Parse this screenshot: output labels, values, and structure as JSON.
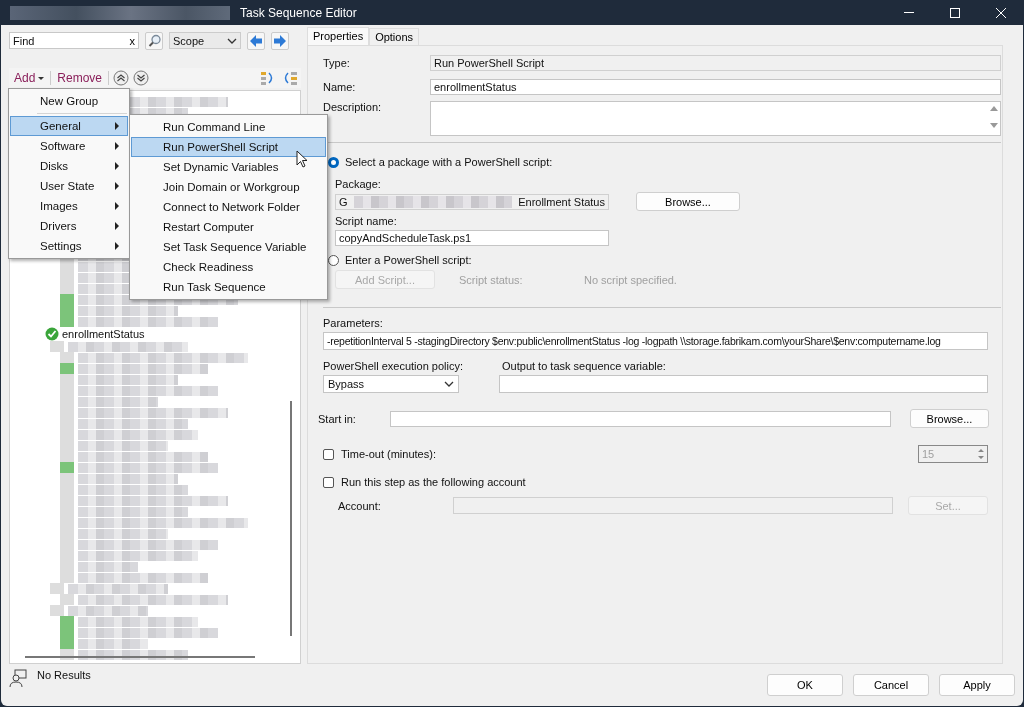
{
  "window": {
    "title": "Task Sequence Editor"
  },
  "search": {
    "value": "Find",
    "clear_label": "x",
    "scope": "Scope"
  },
  "toolbar": {
    "add": "Add",
    "remove": "Remove"
  },
  "add_menu": [
    {
      "label": "New Group",
      "kind": "item",
      "selected": false
    },
    {
      "label": "General",
      "kind": "submenu",
      "selected": true
    },
    {
      "label": "Software",
      "kind": "submenu",
      "selected": false
    },
    {
      "label": "Disks",
      "kind": "submenu",
      "selected": false
    },
    {
      "label": "User State",
      "kind": "submenu",
      "selected": false
    },
    {
      "label": "Images",
      "kind": "submenu",
      "selected": false
    },
    {
      "label": "Drivers",
      "kind": "submenu",
      "selected": false
    },
    {
      "label": "Settings",
      "kind": "submenu",
      "selected": false
    }
  ],
  "general_submenu": [
    {
      "label": "Run Command Line",
      "selected": false
    },
    {
      "label": "Run PowerShell Script",
      "selected": true
    },
    {
      "label": "Set Dynamic Variables",
      "selected": false
    },
    {
      "label": "Join Domain or Workgroup",
      "selected": false
    },
    {
      "label": "Connect to Network Folder",
      "selected": false
    },
    {
      "label": "Restart Computer",
      "selected": false
    },
    {
      "label": "Set Task Sequence Variable",
      "selected": false
    },
    {
      "label": "Check Readiness",
      "selected": false
    },
    {
      "label": "Run Task Sequence",
      "selected": false
    }
  ],
  "tree": {
    "visible_item": {
      "label": "enrollmentStatus",
      "success": true
    }
  },
  "status_bar": "No Results",
  "tabs": [
    {
      "label": "Properties",
      "selected": true
    },
    {
      "label": "Options",
      "selected": false
    }
  ],
  "properties": {
    "type_label": "Type:",
    "type_value": "Run PowerShell Script",
    "name_label": "Name:",
    "name_value": "enrollmentStatus",
    "description_label": "Description:",
    "sources": [
      {
        "label": "Select a package with a PowerShell script:",
        "selected": true
      },
      {
        "label": "Enter a PowerShell script:",
        "selected": false
      }
    ],
    "package_label": "Package:",
    "package_value_start": "G",
    "package_value_end": "Enrollment Status",
    "package_browse": "Browse...",
    "script_name_label": "Script name:",
    "script_name_value": "copyAndScheduleTask.ps1",
    "add_script": {
      "label": "Add Script...",
      "disabled": true
    },
    "script_status_label": "Script status:",
    "script_status_value": "No script specified.",
    "parameters_label": "Parameters:",
    "parameters_value": "-repetitionInterval 5 -stagingDirectory $env:public\\enrollmentStatus -log -logpath \\\\storage.fabrikam.com\\yourShare\\$env:computername.log",
    "policy_label": "PowerShell execution policy:",
    "policy_value": "Bypass",
    "output_label": "Output to task sequence variable:",
    "start_in_label": "Start in:",
    "start_in_browse": "Browse...",
    "timeout": {
      "label": "Time-out (minutes):",
      "checked": false,
      "value": "15"
    },
    "run_as": {
      "label": "Run this step as the following account",
      "checked": false
    },
    "account_label": "Account:",
    "set_button": {
      "label": "Set...",
      "disabled": true
    }
  },
  "buttons": [
    "OK",
    "Cancel",
    "Apply"
  ]
}
